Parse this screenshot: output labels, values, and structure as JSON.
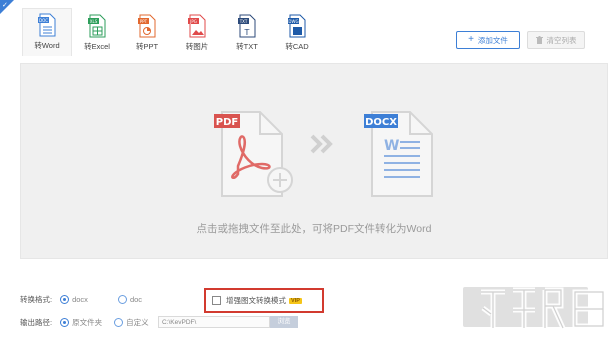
{
  "tabs": [
    {
      "label": "转Word",
      "icon": "word-icon",
      "active": true
    },
    {
      "label": "转Excel",
      "icon": "excel-icon",
      "active": false
    },
    {
      "label": "转PPT",
      "icon": "ppt-icon",
      "active": false
    },
    {
      "label": "转图片",
      "icon": "image-icon",
      "active": false
    },
    {
      "label": "转TXT",
      "icon": "txt-icon",
      "active": false
    },
    {
      "label": "转CAD",
      "icon": "cad-icon",
      "active": false
    }
  ],
  "toolbar": {
    "add_label": "添加文件",
    "clear_label": "清空列表"
  },
  "drop_zone": {
    "pdf_badge": "PDF",
    "docx_badge": "DOCX",
    "hint": "点击或拖拽文件至此处，可将PDF文件转化为Word"
  },
  "format": {
    "label": "转换格式:",
    "options": [
      "docx",
      "doc"
    ],
    "selected": "docx"
  },
  "enhance": {
    "label": "增强图文转换模式",
    "badge": "VIP"
  },
  "output": {
    "label": "输出路径:",
    "options": [
      "原文件夹",
      "自定义"
    ],
    "selected": "原文件夹",
    "path": "C:\\KevPDF\\",
    "browse_label": "浏览"
  },
  "colors": {
    "accent": "#3d7fd6",
    "pdf_red": "#d9534f",
    "docx_blue": "#3d7fd6",
    "highlight_red": "#d23a2f",
    "vip_yellow": "#f5c518"
  }
}
